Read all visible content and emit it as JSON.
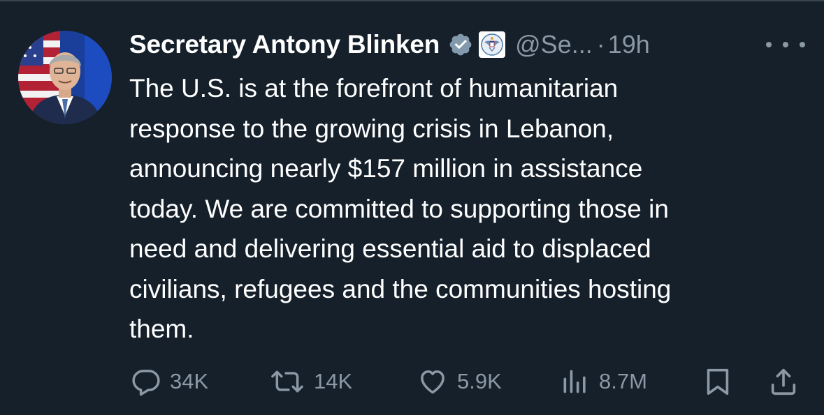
{
  "author": {
    "display_name": "Secretary Antony Blinken",
    "handle": "@Se...",
    "separator": "·",
    "time": "19h",
    "verified_icon": "verified-badge-icon",
    "affiliation_icon": "us-state-department-seal-icon"
  },
  "tweet": {
    "lines": [
      "The U.S. is at the forefront of humanitarian",
      "response to the growing crisis in Lebanon,",
      "announcing nearly $157 million in assistance",
      "today. We are committed to supporting those in",
      "need and delivering essential aid to displaced",
      "civilians, refugees and the communities hosting",
      "them."
    ]
  },
  "actions": {
    "replies": "34K",
    "reposts": "14K",
    "likes": "5.9K",
    "views": "8.7M"
  },
  "colors": {
    "background": "#15202b",
    "text_primary": "#ffffff",
    "text_secondary": "#8b98a5",
    "verified_gray": "#829aab"
  }
}
